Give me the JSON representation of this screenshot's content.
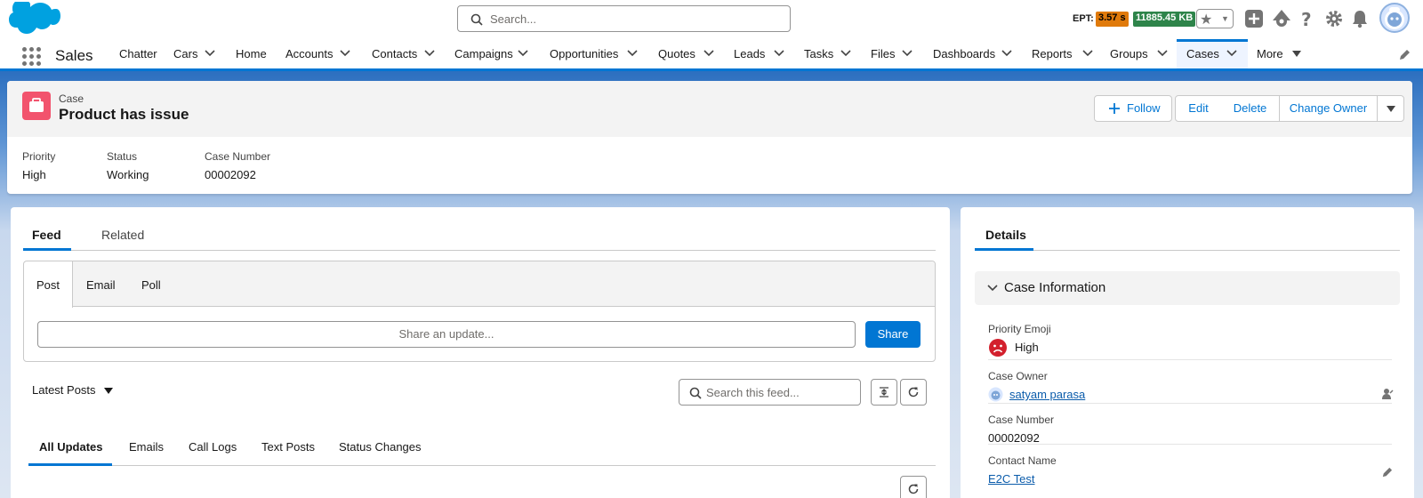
{
  "header": {
    "search_placeholder": "Search...",
    "ept_label": "EPT:",
    "ept_time": "3.57 s",
    "ept_size": "11885.45 KB"
  },
  "nav": {
    "app_name": "Sales",
    "items": [
      {
        "label": "Chatter",
        "has_menu": false
      },
      {
        "label": "Cars",
        "has_menu": true
      },
      {
        "label": "Home",
        "has_menu": false
      },
      {
        "label": "Accounts",
        "has_menu": true
      },
      {
        "label": "Contacts",
        "has_menu": true
      },
      {
        "label": "Campaigns",
        "has_menu": true
      },
      {
        "label": "Opportunities",
        "has_menu": true
      },
      {
        "label": "Quotes",
        "has_menu": true
      },
      {
        "label": "Leads",
        "has_menu": true
      },
      {
        "label": "Tasks",
        "has_menu": true
      },
      {
        "label": "Files",
        "has_menu": true
      },
      {
        "label": "Dashboards",
        "has_menu": true
      },
      {
        "label": "Reports",
        "has_menu": true
      },
      {
        "label": "Groups",
        "has_menu": true
      },
      {
        "label": "Cases",
        "has_menu": true,
        "active": true
      },
      {
        "label": "More",
        "has_menu": true
      }
    ]
  },
  "record": {
    "object_type": "Case",
    "title": "Product has issue",
    "actions": {
      "follow": "Follow",
      "edit": "Edit",
      "delete": "Delete",
      "change_owner": "Change Owner"
    },
    "highlights": [
      {
        "label": "Priority",
        "value": "High"
      },
      {
        "label": "Status",
        "value": "Working"
      },
      {
        "label": "Case Number",
        "value": "00002092"
      }
    ]
  },
  "feed": {
    "tabs": {
      "feed": "Feed",
      "related": "Related"
    },
    "publisher_tabs": {
      "post": "Post",
      "email": "Email",
      "poll": "Poll"
    },
    "share_placeholder": "Share an update...",
    "share_button": "Share",
    "sort_label": "Latest Posts",
    "search_placeholder": "Search this feed...",
    "filters": {
      "all": "All Updates",
      "emails": "Emails",
      "call_logs": "Call Logs",
      "text_posts": "Text Posts",
      "status_changes": "Status Changes"
    }
  },
  "details": {
    "tab": "Details",
    "section": "Case Information",
    "fields": {
      "priority_emoji": {
        "label": "Priority Emoji",
        "value": "High"
      },
      "owner": {
        "label": "Case Owner",
        "value": "satyam parasa"
      },
      "case_number": {
        "label": "Case Number",
        "value": "00002092"
      },
      "contact": {
        "label": "Contact Name",
        "value": "E2C Test"
      }
    }
  },
  "colors": {
    "brand": "#0176d3",
    "case_icon": "#f2536d",
    "ept_time": "#e07a0b",
    "ept_size": "#2e844a"
  }
}
